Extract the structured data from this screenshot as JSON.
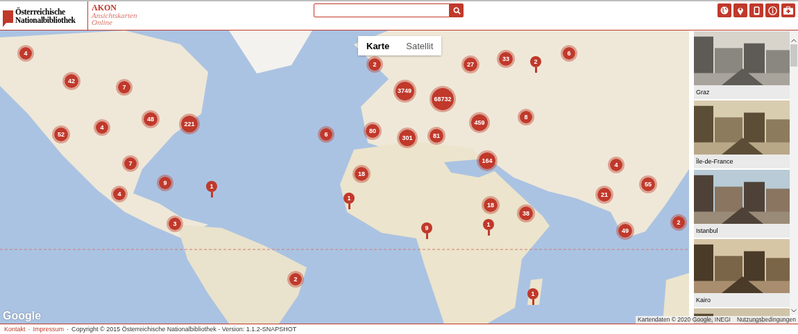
{
  "header": {
    "logo": {
      "line_1": "Österreichische",
      "line_2": "Nationalbibliothek"
    },
    "app": {
      "title": "AKON",
      "subtitle_1": "Ansichtskarten",
      "subtitle_2": "Online"
    }
  },
  "map": {
    "map_types": [
      {
        "label": "Karte",
        "selected": true
      },
      {
        "label": "Satellit",
        "selected": false
      }
    ],
    "markers": [
      {
        "count": "4",
        "kind": "cluster"
      },
      {
        "count": "42",
        "kind": "cluster"
      },
      {
        "count": "7",
        "kind": "cluster"
      },
      {
        "count": "48",
        "kind": "cluster"
      },
      {
        "count": "221",
        "kind": "cluster"
      },
      {
        "count": "4",
        "kind": "cluster"
      },
      {
        "count": "52",
        "kind": "cluster"
      },
      {
        "count": "7",
        "kind": "cluster"
      },
      {
        "count": "9",
        "kind": "cluster"
      },
      {
        "count": "4",
        "kind": "cluster"
      },
      {
        "count": "1",
        "kind": "pin"
      },
      {
        "count": "3",
        "kind": "cluster"
      },
      {
        "count": "2",
        "kind": "cluster"
      },
      {
        "count": "6",
        "kind": "cluster"
      },
      {
        "count": "80",
        "kind": "cluster"
      },
      {
        "count": "2",
        "kind": "cluster"
      },
      {
        "count": "3749",
        "kind": "cluster"
      },
      {
        "count": "68732",
        "kind": "cluster"
      },
      {
        "count": "301",
        "kind": "cluster"
      },
      {
        "count": "81",
        "kind": "cluster"
      },
      {
        "count": "459",
        "kind": "cluster"
      },
      {
        "count": "27",
        "kind": "cluster"
      },
      {
        "count": "33",
        "kind": "cluster"
      },
      {
        "count": "2",
        "kind": "pin"
      },
      {
        "count": "6",
        "kind": "cluster"
      },
      {
        "count": "8",
        "kind": "cluster"
      },
      {
        "count": "18",
        "kind": "cluster"
      },
      {
        "count": "1",
        "kind": "pin"
      },
      {
        "count": "164",
        "kind": "cluster"
      },
      {
        "count": "18",
        "kind": "cluster"
      },
      {
        "count": "1",
        "kind": "pin"
      },
      {
        "count": "9",
        "kind": "pin"
      },
      {
        "count": "38",
        "kind": "cluster"
      },
      {
        "count": "1",
        "kind": "pin"
      },
      {
        "count": "4",
        "kind": "cluster"
      },
      {
        "count": "55",
        "kind": "cluster"
      },
      {
        "count": "21",
        "kind": "cluster"
      },
      {
        "count": "49",
        "kind": "cluster"
      },
      {
        "count": "2",
        "kind": "cluster"
      }
    ],
    "google_logo": "Google",
    "attribution": "Kartendaten © 2020 Google, INEGI",
    "terms_link": "Nutzungsbedingungen"
  },
  "postcards": [
    {
      "caption": "Graz"
    },
    {
      "caption": "Île-de-France"
    },
    {
      "caption": "Istanbul"
    },
    {
      "caption": "Kairo"
    }
  ],
  "footer": {
    "links": [
      "Kontakt",
      "Impressum"
    ],
    "separator": "·",
    "copyright": "Copyright © 2015 Österreichische Nationalbibliothek - Version: 1.1.2-SNAPSHOT"
  }
}
